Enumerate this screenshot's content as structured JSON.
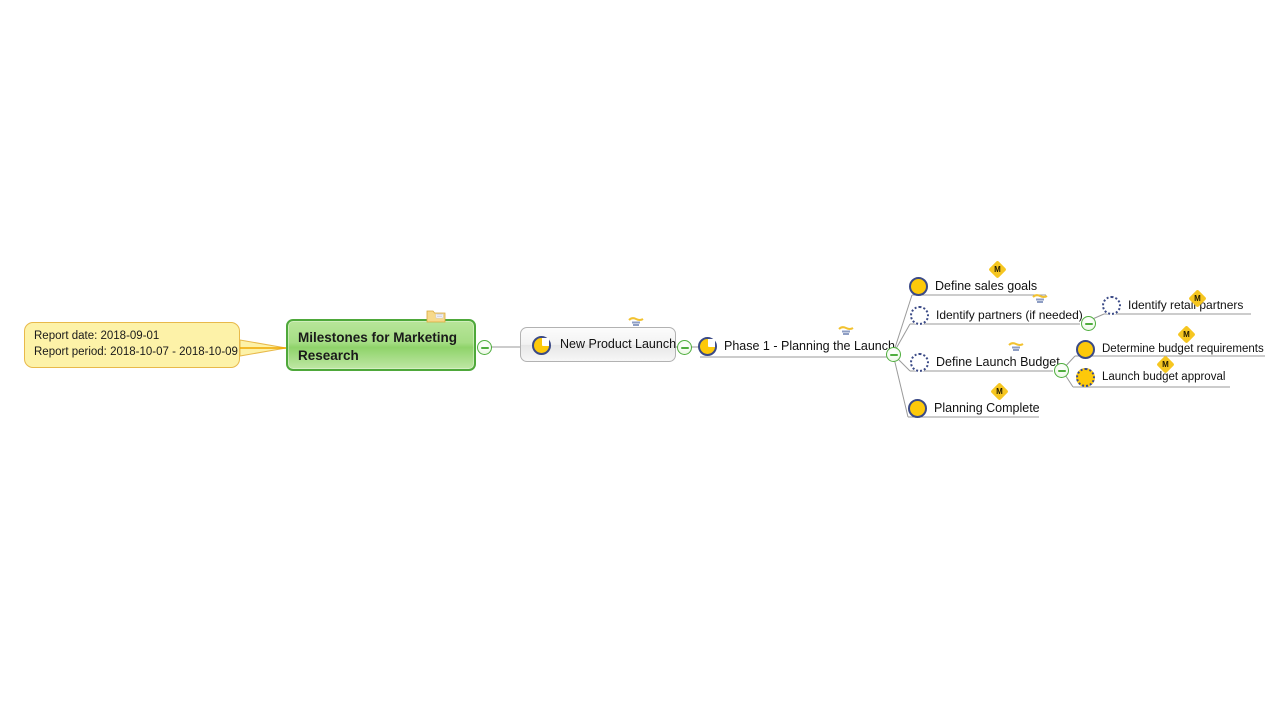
{
  "document": {
    "title": "Milestones for Marketing Research",
    "type": "mind-map"
  },
  "callout": {
    "name": "report-info-note",
    "line1": "Report date: 2018-09-01",
    "line2": "Report period: 2018-10-07 - 2018-10-09",
    "fill_color": "#fdf2a8",
    "border_color": "#e8b94a"
  },
  "root": {
    "label": "Milestones for Marketing Research",
    "icon": "folder-icon",
    "fill_color": "#a5dd84",
    "border_color": "#4ea83a",
    "collapse_label": "collapse"
  },
  "topic": {
    "label": "New Product Launch",
    "icon": "pie-quarter-icon",
    "note_icon": "task-note-icon",
    "fill_color": "#f2f2f2",
    "border_color": "#b2b2b2"
  },
  "phase": {
    "label": "Phase 1 - Planning the Launch",
    "icon": "pie-quarter-icon",
    "note_icon": "task-note-icon"
  },
  "branches": [
    {
      "id": "define-sales-goals",
      "label": "Define sales goals",
      "icon": "filled-circle-icon",
      "milestone": "M",
      "has_note": false,
      "has_collapse": false
    },
    {
      "id": "identify-partners",
      "label": "Identify partners (if needed)",
      "icon": "ring-circle-icon",
      "milestone": null,
      "has_note": true,
      "has_collapse": true
    },
    {
      "id": "define-launch-budget",
      "label": "Define Launch Budget",
      "icon": "ring-circle-icon",
      "milestone": null,
      "has_note": true,
      "has_collapse": true
    },
    {
      "id": "planning-complete",
      "label": "Planning Complete",
      "icon": "filled-circle-icon",
      "milestone": "M",
      "has_note": false,
      "has_collapse": false
    }
  ],
  "subbranches": [
    {
      "id": "identify-retail-partners",
      "parent": "identify-partners",
      "label": "Identify retail partners",
      "icon": "ring-circle-icon",
      "milestone": "M"
    },
    {
      "id": "determine-budget-requirements",
      "parent": "define-launch-budget",
      "label": "Determine budget requirements",
      "icon": "filled-circle-icon",
      "milestone": "M"
    },
    {
      "id": "launch-budget-approval",
      "parent": "define-launch-budget",
      "label": "Launch budget approval",
      "icon": "filled-dotted-circle-icon",
      "milestone": "M"
    }
  ],
  "colors": {
    "milestone_badge": "#f6c620",
    "status_fill": "#fdc90a",
    "status_border": "#3b4a86",
    "collapse_green": "#4fae3e",
    "link_line": "#9a9a9a",
    "callout_link": "#f0a800"
  }
}
